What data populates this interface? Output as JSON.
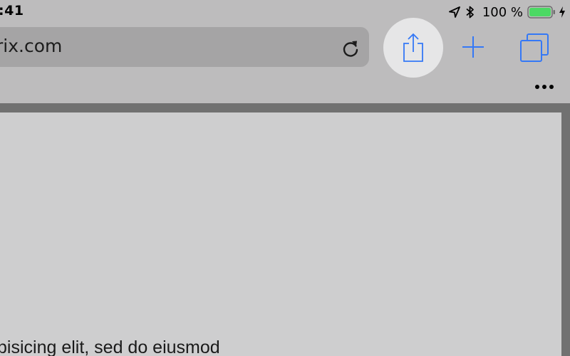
{
  "status_bar": {
    "time": ":41",
    "battery_percent": "100 %",
    "icons": [
      "location-arrow-icon",
      "bluetooth-icon",
      "battery-icon",
      "charging-bolt-icon"
    ],
    "battery_color": "#4cd964"
  },
  "toolbar": {
    "url": "rix.com",
    "reload_icon": "reload-icon",
    "share_icon": "share-icon",
    "new_tab_icon": "plus-icon",
    "tabs_icon": "tabs-icon",
    "more_icon": "ellipsis-icon",
    "accent_color": "#3478f6"
  },
  "page": {
    "visible_text": "pisicing elit, sed do eiusmod"
  }
}
